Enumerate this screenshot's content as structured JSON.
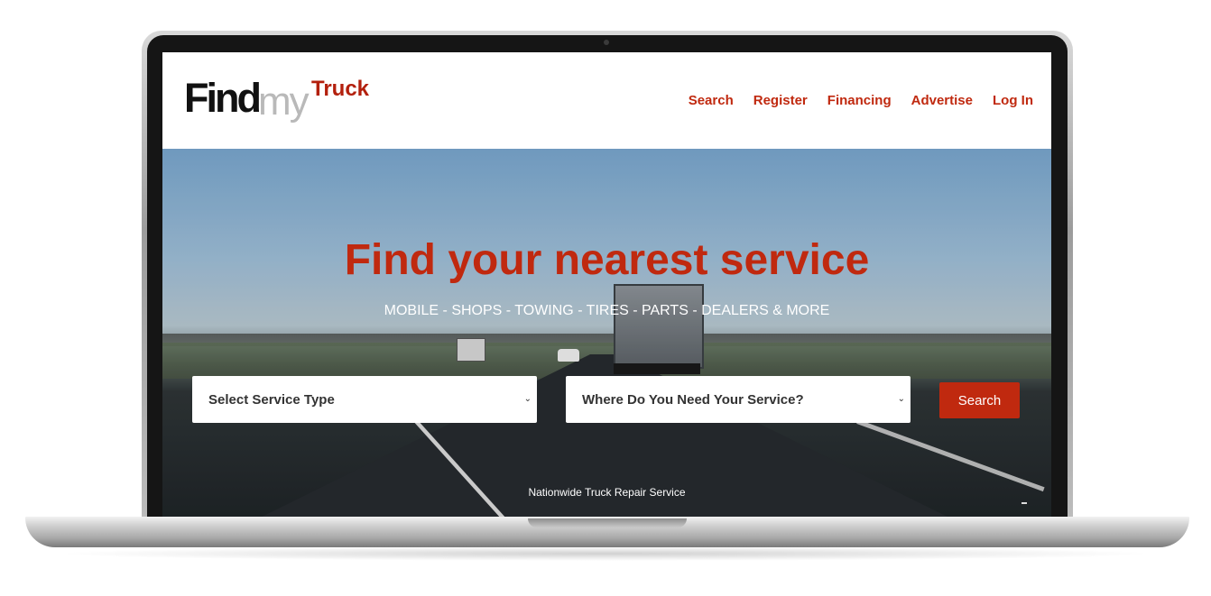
{
  "header": {
    "logo": {
      "find": "Find",
      "my": "my",
      "truck": "Truck"
    },
    "nav": [
      "Search",
      "Register",
      "Financing",
      "Advertise",
      "Log In"
    ]
  },
  "hero": {
    "title": "Find your nearest service",
    "subtitle": "MOBILE - SHOPS - TOWING - TIRES - PARTS - DEALERS & MORE",
    "service_select": "Select Service Type",
    "location_select": "Where Do You Need Your Service?",
    "search_button": "Search",
    "footer_note": "Nationwide Truck Repair Service"
  },
  "colors": {
    "brand_red": "#c0290f",
    "logo_gray": "#b9b9b9",
    "text_dark": "#111111"
  },
  "icons": {
    "dropdown": "chevron-down-icon",
    "camera": "camera-icon"
  }
}
